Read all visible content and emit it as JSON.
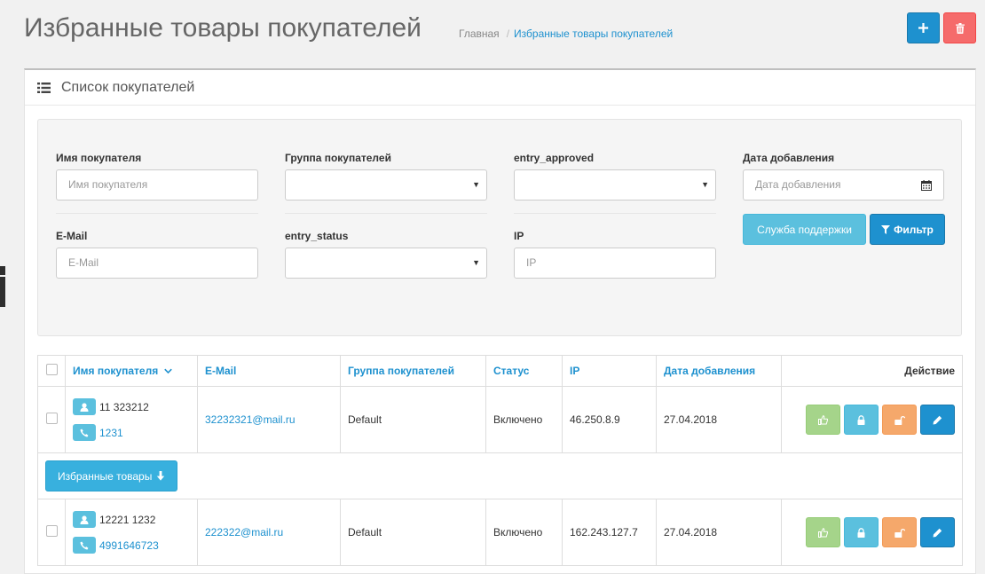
{
  "header": {
    "title": "Избранные товары покупателей",
    "breadcrumb": {
      "home": "Главная",
      "separator": "/",
      "current": "Избранные товары покупателей"
    },
    "add_icon": "plus-icon",
    "delete_icon": "trash-icon"
  },
  "panel": {
    "title": "Список покупателей",
    "icon": "list-icon"
  },
  "filter": {
    "name": {
      "label": "Имя покупателя",
      "placeholder": "Имя покупателя"
    },
    "group": {
      "label": "Группа покупателей",
      "value": ""
    },
    "approved": {
      "label": "entry_approved",
      "value": ""
    },
    "date": {
      "label": "Дата добавления",
      "placeholder": "Дата добавления"
    },
    "email": {
      "label": "E-Mail",
      "placeholder": "E-Mail"
    },
    "status": {
      "label": "entry_status",
      "value": ""
    },
    "ip": {
      "label": "IP",
      "placeholder": "IP"
    },
    "support_button": "Служба поддержки",
    "filter_button": "Фильтр"
  },
  "table": {
    "columns": {
      "name": "Имя покупателя",
      "email": "E-Mail",
      "group": "Группа покупателей",
      "status": "Статус",
      "ip": "IP",
      "date": "Дата добавления",
      "action": "Действие"
    },
    "rows": [
      {
        "name": "11 323212",
        "phone": "1231",
        "email": "32232321@mail.ru",
        "group": "Default",
        "status": "Включено",
        "ip": "46.250.8.9",
        "date": "27.04.2018"
      },
      {
        "name": "12221 1232",
        "phone": "4991646723",
        "email": "222322@mail.ru",
        "group": "Default",
        "status": "Включено",
        "ip": "162.243.127.7",
        "date": "27.04.2018"
      }
    ],
    "favorites_button": "Избранные товары"
  },
  "colors": {
    "primary": "#1e91cf",
    "danger": "#f56b6b",
    "info": "#5bc0de",
    "success": "#a5d48a",
    "warning": "#f5a86b"
  }
}
